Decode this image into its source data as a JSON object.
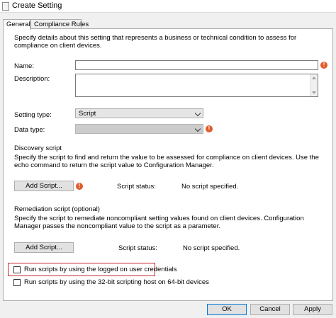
{
  "window": {
    "title": "Create Setting"
  },
  "tabs": [
    {
      "label": "General",
      "active": true
    },
    {
      "label": "Compliance Rules",
      "active": false
    }
  ],
  "intro": "Specify details about this setting that represents a business or technical condition to assess for compliance on client devices.",
  "form": {
    "name_label": "Name:",
    "name_value": "",
    "description_label": "Description:",
    "description_value": "",
    "setting_type_label": "Setting type:",
    "setting_type_value": "Script",
    "data_type_label": "Data type:",
    "data_type_value": ""
  },
  "discovery": {
    "heading": "Discovery script",
    "text": "Specify the script to find and return the value to be assessed for compliance on client devices. Use the echo command to return the script value to Configuration Manager.",
    "button_label": "Add Script...",
    "status_label": "Script status:",
    "status_value": "No script specified."
  },
  "remediation": {
    "heading": "Remediation script (optional)",
    "text": "Specify the script to remediate noncompliant setting values found on client devices. Configuration Manager passes the noncompliant value to the script as a parameter.",
    "button_label": "Add Script...",
    "status_label": "Script status:",
    "status_value": "No script specified."
  },
  "options": {
    "logged_on": {
      "label": "Run scripts by using the logged on user credentials",
      "checked": false
    },
    "host_32bit": {
      "label": "Run scripts by using the 32-bit scripting host on 64-bit devices",
      "checked": false
    }
  },
  "footer": {
    "ok_label": "OK",
    "cancel_label": "Cancel",
    "apply_label": "Apply"
  },
  "colors": {
    "warning": "#e05a2b",
    "highlight": "#c1272d",
    "accent": "#0078d7"
  },
  "icons": {
    "warning": "warning-icon",
    "dropdown": "chevron-down-icon"
  }
}
